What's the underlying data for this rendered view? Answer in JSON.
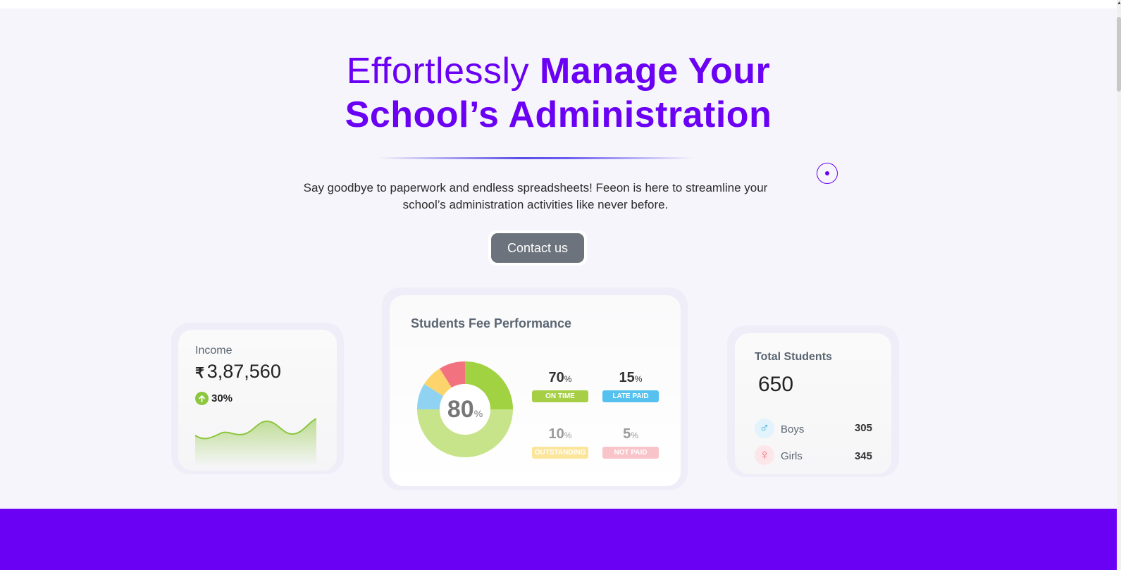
{
  "hero": {
    "headline_light": "Effortlessly",
    "headline_bold_1": "Manage Your",
    "headline_bold_2": "School’s Administration",
    "subtitle_line1": "Say goodbye to paperwork and endless spreadsheets! Feeon is here to streamline your",
    "subtitle_line2": "school’s administration activities like never before.",
    "cta_label": "Contact us",
    "accent_color": "#6a00f4"
  },
  "income_card": {
    "label": "Income",
    "currency_symbol": "₹",
    "value": "3,87,560",
    "change": "30%",
    "change_icon": "arrow-up-icon"
  },
  "fee_card": {
    "title": "Students Fee Performance",
    "donut_value": "80",
    "donut_unit": "%",
    "stats": [
      {
        "value": "70",
        "unit": "%",
        "label": "ON TIME",
        "color": "#a6cf45"
      },
      {
        "value": "15",
        "unit": "%",
        "label": "LATE PAID",
        "color": "#56c1ef"
      },
      {
        "value": "10",
        "unit": "%",
        "label": "OUTSTANDING",
        "color": "#fbe59a"
      },
      {
        "value": "5",
        "unit": "%",
        "label": "NOT PAID",
        "color": "#f9c4c9"
      }
    ]
  },
  "students_card": {
    "label": "Total Students",
    "value": "650",
    "boys_label": "Boys",
    "boys_count": "305",
    "boys_icon": "male-icon",
    "girls_label": "Girls",
    "girls_count": "345",
    "girls_icon": "female-icon"
  }
}
